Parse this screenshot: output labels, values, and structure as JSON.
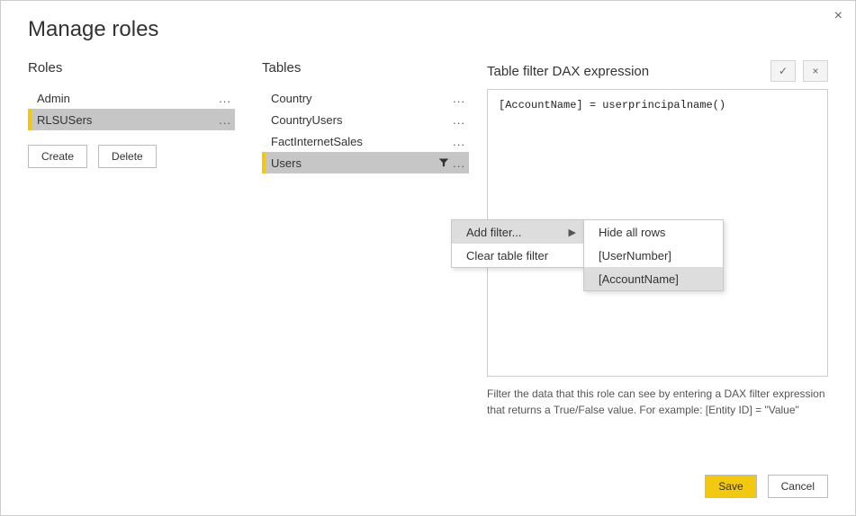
{
  "title": "Manage roles",
  "roles": {
    "heading": "Roles",
    "items": [
      {
        "label": "Admin",
        "selected": false
      },
      {
        "label": "RLSUSers",
        "selected": true
      }
    ],
    "buttons": {
      "create": "Create",
      "delete": "Delete"
    }
  },
  "tables": {
    "heading": "Tables",
    "items": [
      {
        "label": "Country",
        "selected": false,
        "filter": false
      },
      {
        "label": "CountryUsers",
        "selected": false,
        "filter": false
      },
      {
        "label": "FactInternetSales",
        "selected": false,
        "filter": false
      },
      {
        "label": "Users",
        "selected": true,
        "filter": true
      }
    ]
  },
  "expr": {
    "heading": "Table filter DAX expression",
    "code": "[AccountName] = userprincipalname()",
    "hint": "Filter the data that this role can see by entering a DAX filter expression that returns a True/False value. For example: [Entity ID] = \"Value\"",
    "confirm_icon": "✓",
    "cancel_icon": "×"
  },
  "context_menu_1": {
    "items": [
      {
        "label": "Add filter...",
        "submenu": true,
        "hovered": true
      },
      {
        "label": "Clear table filter",
        "submenu": false,
        "hovered": false
      }
    ]
  },
  "context_menu_2": {
    "items": [
      {
        "label": "Hide all rows",
        "hovered": false
      },
      {
        "label": "[UserNumber]",
        "hovered": false
      },
      {
        "label": "[AccountName]",
        "hovered": true
      }
    ]
  },
  "footer": {
    "save": "Save",
    "cancel": "Cancel"
  },
  "close": "×"
}
